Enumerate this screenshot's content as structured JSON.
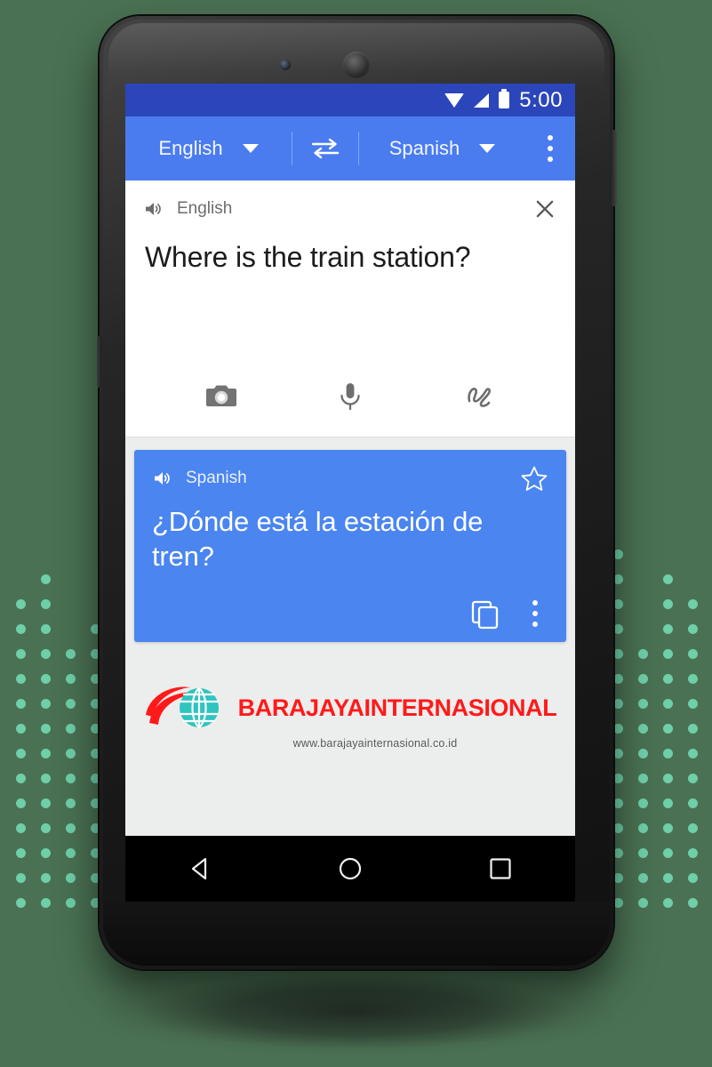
{
  "background": {
    "color": "#4a7153",
    "accent_dot_color": "#6ecfa8"
  },
  "phone": {
    "hardware": {
      "earpiece": "earpiece-speaker",
      "front_camera": "front-camera",
      "volume_button": "volume-button",
      "power_button": "power-button"
    }
  },
  "statusbar": {
    "time": "5:00",
    "icons": [
      "wifi-icon",
      "signal-icon",
      "battery-icon"
    ],
    "bg": "#2a46ba"
  },
  "toolbar": {
    "source_language": "English",
    "target_language": "Spanish",
    "swap_icon": "swap-arrows-icon",
    "overflow_icon": "overflow-menu-icon",
    "bg": "#4a7cf0"
  },
  "input_card": {
    "speaker_icon": "speaker-icon",
    "language_label": "English",
    "close_icon": "close-icon",
    "text": "Where is the train station?",
    "actions": [
      {
        "name": "camera-input",
        "icon": "camera-icon"
      },
      {
        "name": "voice-input",
        "icon": "microphone-icon"
      },
      {
        "name": "handwriting-input",
        "icon": "handwriting-icon"
      }
    ]
  },
  "translation_card": {
    "speaker_icon": "speaker-icon",
    "language_label": "Spanish",
    "star_icon": "star-outline-icon",
    "text": "¿Dónde está la estación de tren?",
    "copy_icon": "copy-icon",
    "overflow_icon": "overflow-menu-icon",
    "bg": "#4a85f0"
  },
  "watermark": {
    "brand": "BARAJAYAINTERNASIONAL",
    "url": "www.barajayainternasional.co.id",
    "brand_color": "#ff1a1a",
    "globe_color": "#2fc4c0"
  },
  "navbar": {
    "buttons": [
      {
        "name": "back-button",
        "icon": "back-triangle-icon"
      },
      {
        "name": "home-button",
        "icon": "home-circle-icon"
      },
      {
        "name": "recents-button",
        "icon": "recents-square-icon"
      }
    ]
  }
}
